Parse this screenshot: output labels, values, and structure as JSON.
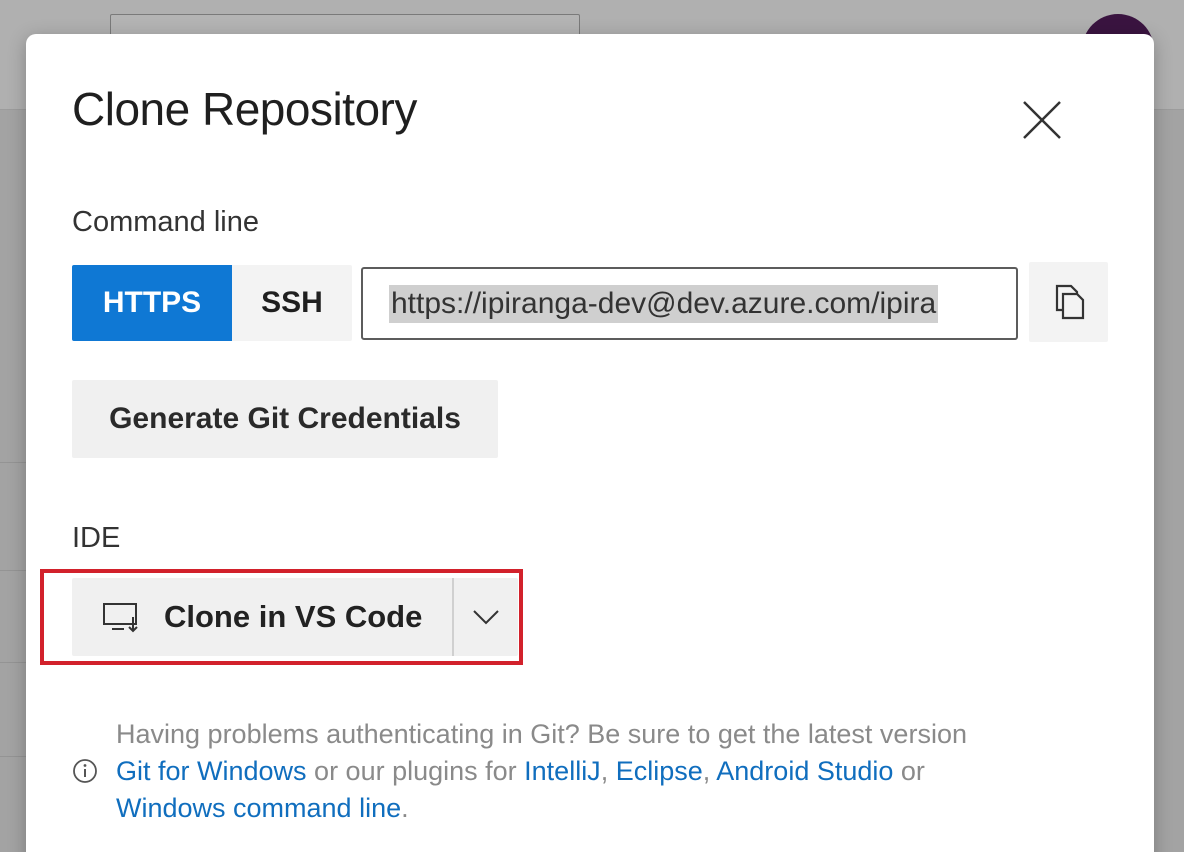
{
  "dialog": {
    "title": "Clone Repository",
    "close_icon": "close-icon"
  },
  "command_line": {
    "label": "Command line",
    "protocols": [
      {
        "label": "HTTPS",
        "selected": true
      },
      {
        "label": "SSH",
        "selected": false
      }
    ],
    "clone_url": "https://ipiranga-dev@dev.azure.com/ipira",
    "copy_icon": "copy-icon",
    "generate_credentials_label": "Generate Git Credentials"
  },
  "ide": {
    "label": "IDE",
    "clone_button_label": "Clone in VS Code",
    "clone_icon": "monitor-download-icon",
    "dropdown_icon": "chevron-down-icon",
    "highlight_color": "#d2212b"
  },
  "help": {
    "text_1": "Having problems authenticating in Git? Be sure to get the latest version",
    "link_git_for_windows": "Git for Windows",
    "text_2": " or our plugins for ",
    "link_intellij": "IntelliJ",
    "text_3": ", ",
    "link_eclipse": "Eclipse",
    "text_4": ", ",
    "link_android_studio": "Android Studio",
    "text_5": " or",
    "link_windows_cmd": "Windows command line",
    "text_6": ".",
    "info_icon": "info-icon"
  },
  "colors": {
    "accent": "#0f78d4",
    "link": "#106ebe"
  }
}
